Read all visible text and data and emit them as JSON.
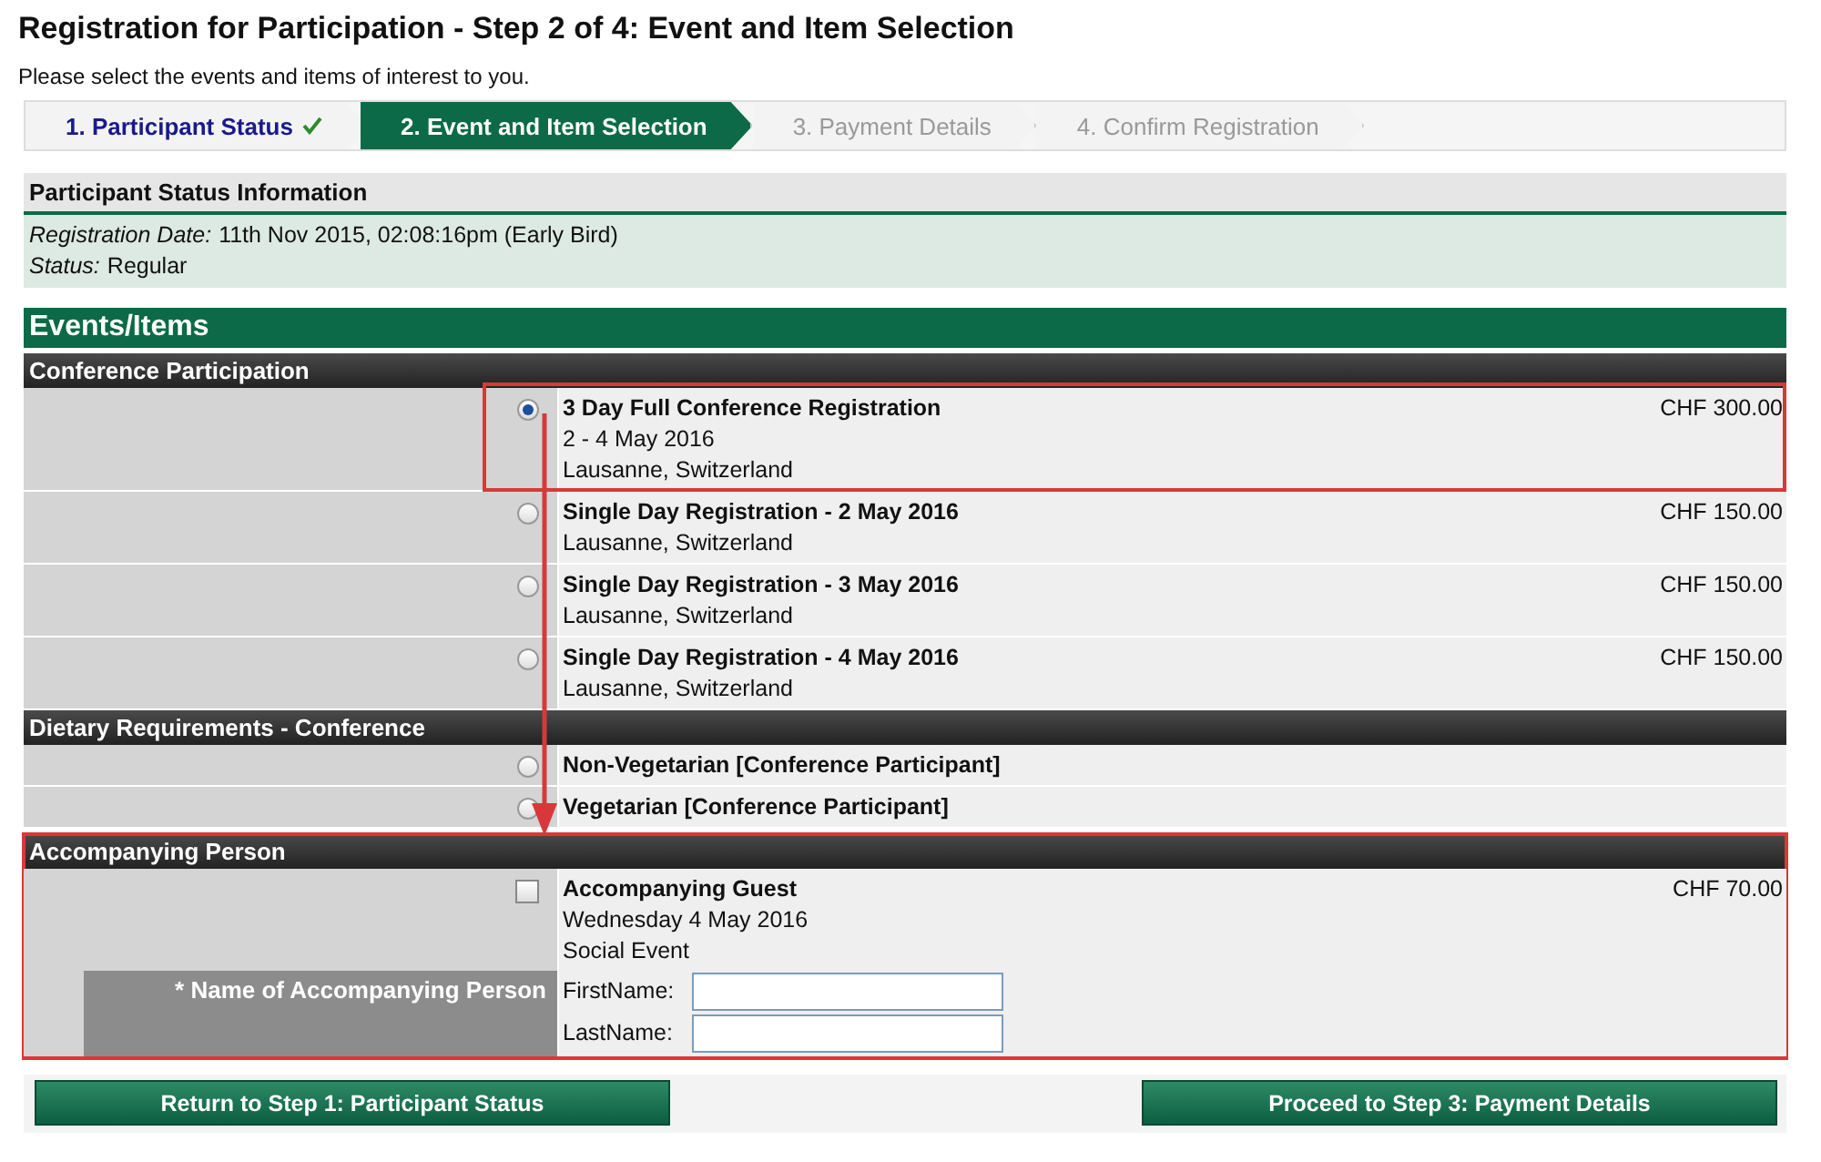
{
  "page": {
    "title": "Registration for Participation - Step 2 of 4: Event and Item Selection",
    "subtitle": "Please select the events and items of interest to you."
  },
  "steps": [
    {
      "label": "1. Participant Status",
      "completed": true,
      "selected": false
    },
    {
      "label": "2. Event and Item Selection",
      "completed": false,
      "selected": true
    },
    {
      "label": "3. Payment Details",
      "completed": false,
      "selected": false
    },
    {
      "label": "4. Confirm Registration",
      "completed": false,
      "selected": false
    }
  ],
  "status_panel": {
    "title": "Participant Status Information",
    "rows": [
      {
        "label": "Registration Date:",
        "value": "11th Nov 2015, 02:08:16pm (Early Bird)"
      },
      {
        "label": "Status:",
        "value": "Regular"
      }
    ]
  },
  "events": {
    "title": "Events/Items",
    "sections": [
      {
        "title": "Conference Participation",
        "highlighted": false,
        "items": [
          {
            "kind": "radio",
            "selected": true,
            "highlighted": true,
            "title": "3 Day Full Conference Registration",
            "lines": [
              "2 - 4 May 2016",
              "Lausanne, Switzerland"
            ],
            "price": "CHF 300.00"
          },
          {
            "kind": "radio",
            "selected": false,
            "highlighted": false,
            "title": "Single Day Registration - 2 May 2016",
            "lines": [
              "Lausanne, Switzerland"
            ],
            "price": "CHF 150.00"
          },
          {
            "kind": "radio",
            "selected": false,
            "highlighted": false,
            "title": "Single Day Registration - 3 May 2016",
            "lines": [
              "Lausanne, Switzerland"
            ],
            "price": "CHF 150.00"
          },
          {
            "kind": "radio",
            "selected": false,
            "highlighted": false,
            "title": "Single Day Registration - 4 May 2016",
            "lines": [
              "Lausanne, Switzerland"
            ],
            "price": "CHF 150.00"
          }
        ]
      },
      {
        "title": "Dietary Requirements - Conference",
        "highlighted": false,
        "items": [
          {
            "kind": "radio",
            "selected": false,
            "highlighted": false,
            "title": "Non-Vegetarian [Conference Participant]"
          },
          {
            "kind": "radio",
            "selected": false,
            "highlighted": false,
            "title": "Vegetarian [Conference Participant]"
          }
        ]
      },
      {
        "title": "Accompanying Person",
        "highlighted": true,
        "items": [
          {
            "kind": "checkbox",
            "checked": false,
            "highlighted": false,
            "title": "Accompanying Guest",
            "lines": [
              "Wednesday 4 May 2016",
              "Social Event"
            ],
            "price": "CHF 70.00",
            "required_label": "* Name of Accompanying Person",
            "fields": [
              {
                "label": "FirstName:"
              },
              {
                "label": "LastName:"
              }
            ]
          }
        ]
      }
    ]
  },
  "buttons": [
    {
      "label": "Return to Step 1: Participant Status"
    },
    {
      "label": "Proceed to Step 3: Payment Details"
    }
  ]
}
